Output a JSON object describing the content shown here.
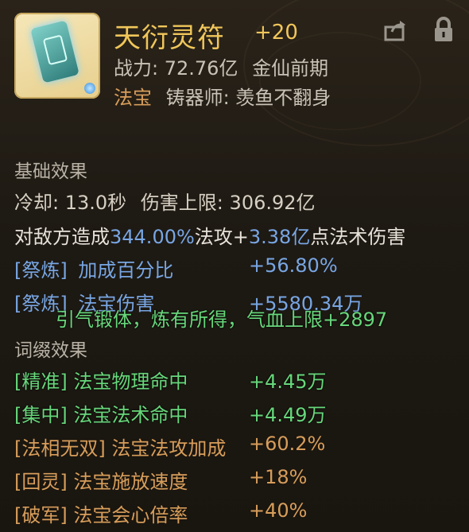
{
  "header": {
    "title": "天衍灵符",
    "enhance": "+20",
    "power_label": "战力:",
    "power_value": "72.76亿",
    "realm": "金仙前期",
    "type": "法宝",
    "forger_label": "铸器师:",
    "forger_name": "羡鱼不翻身"
  },
  "basic": {
    "title": "基础效果",
    "cooldown_label": "冷却:",
    "cooldown_value": "13.0秒",
    "cap_label": "伤害上限:",
    "cap_value": "306.92亿",
    "damage_prefix": "对敌方造成",
    "damage_pct": "344.00%",
    "damage_mid1": "法攻+",
    "damage_flat": "3.38亿",
    "damage_suffix": "点法术伤害",
    "refine1_tag": "[祭炼]",
    "refine1_label": "加成百分比",
    "refine1_value": "+56.80%",
    "refine2_tag": "[祭炼]",
    "refine2_label": "法宝伤害",
    "refine2_value": "+5580.34万"
  },
  "notice": "引气锻体，炼有所得，气血上限+2897",
  "affixes": {
    "title": "词缀效果",
    "items": [
      {
        "tag": "[精准]",
        "label": "法宝物理命中",
        "value": "+4.45万"
      },
      {
        "tag": "[集中]",
        "label": "法宝法术命中",
        "value": "+4.49万"
      },
      {
        "tag": "[法相无双]",
        "label": "法宝法攻加成",
        "value": "+60.2%"
      },
      {
        "tag": "[回灵]",
        "label": "法宝施放速度",
        "value": "+18%"
      },
      {
        "tag": "[破军]",
        "label": "法宝会心倍率",
        "value": "+40%"
      }
    ]
  },
  "icons": {
    "share": "share-icon",
    "lock": "lock-icon"
  },
  "colors": {
    "title": "#f0c65a",
    "blue": "#78a6e3",
    "green": "#67d77b",
    "type": "#d79d5a"
  }
}
